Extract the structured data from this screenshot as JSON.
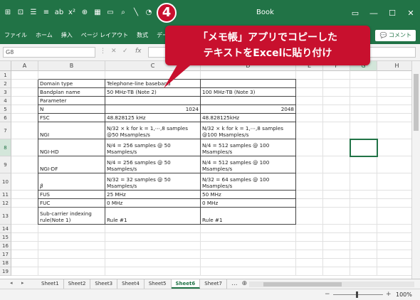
{
  "titlebar": {
    "title": "Book",
    "qat_icons": [
      "grid-icon",
      "border-icon",
      "align-icon",
      "align-justify-icon",
      "strikethrough-icon",
      "superscript-icon",
      "subscript-icon",
      "table-icon",
      "image-icon",
      "search-icon",
      "line-icon",
      "chart-icon"
    ],
    "qat_labels": [
      "⊞",
      "⊡",
      "☰",
      "≡",
      "ab",
      "x²",
      "⊕",
      "▦",
      "▭",
      "⌕",
      "╲",
      "◔",
      "x₂"
    ],
    "window_buttons": [
      "▭",
      "―",
      "☐",
      "✕"
    ]
  },
  "ribbon": {
    "tabs": [
      "ファイル",
      "ホーム",
      "挿入",
      "ページ レイアウト",
      "数式",
      "データ"
    ],
    "comment_label": "コメント"
  },
  "formula_bar": {
    "name_box": "G8",
    "fx": "fx"
  },
  "grid": {
    "columns": [
      "A",
      "B",
      "C",
      "D",
      "E",
      "F",
      "G",
      "H"
    ],
    "rows": [
      "1",
      "2",
      "3",
      "4",
      "5",
      "6",
      "7",
      "8",
      "9",
      "10",
      "11",
      "12",
      "13",
      "14",
      "15",
      "16",
      "17",
      "18",
      "19"
    ],
    "cells": {
      "B2": "Domain type",
      "C2": "Telephone-line baseband",
      "B3": "Bandplan name",
      "C3": "50 MHz-TB (Note 2)",
      "D3": "100 MHz-TB (Note 3)",
      "B4": "Parameter",
      "B5": "N",
      "C5": "1024",
      "D5": "2048",
      "B6": "FSC",
      "C6": "48.828125 kHz",
      "D6": "48.828125kHz",
      "B7": "NGI",
      "C7": "N/32 × k for k = 1,⋯,8 samples @50 Msamples/s",
      "D7": "N/32 × k for k = 1,⋯,8 samples @100 Msamples/s",
      "B8": "NGI-HD",
      "C8": "N/4 = 256 samples @ 50 Msamples/s",
      "D8": "N/4 = 512 samples @ 100 Msamples/s",
      "B9": "NGI-DF",
      "C9": "N/4 = 256 samples @ 50 Msamples/s",
      "D9": "N/4 = 512 samples @ 100 Msamples/s",
      "B10": "β",
      "C10": "N/32 = 32 samples @ 50 Msamples/s",
      "D10": "N/32 = 64 samples @ 100 Msamples/s",
      "B11": "FUS",
      "C11": "25 MHz",
      "D11": "50 MHz",
      "B12": "FUC",
      "C12": "0 MHz",
      "D12": "0 MHz",
      "B13": "Sub-carrier indexing rule(Note 1)",
      "C13": "Rule #1",
      "D13": "Rule #1"
    },
    "selected_cell": "G8"
  },
  "sheets": {
    "tabs": [
      "Sheet1",
      "Sheet2",
      "Sheet3",
      "Sheet4",
      "Sheet5",
      "Sheet6",
      "Sheet7"
    ],
    "active": "Sheet6",
    "more": "...",
    "add": "⊕"
  },
  "statusbar": {
    "zoom_minus": "−",
    "zoom_plus": "+",
    "zoom_level": "100%"
  },
  "callout": {
    "step": "4",
    "line1": "「メモ帳」アプリでコピーした",
    "line2": "テキストをExcelに貼り付け"
  },
  "colors": {
    "excel_green": "#217346",
    "callout_red": "#c8102e"
  }
}
